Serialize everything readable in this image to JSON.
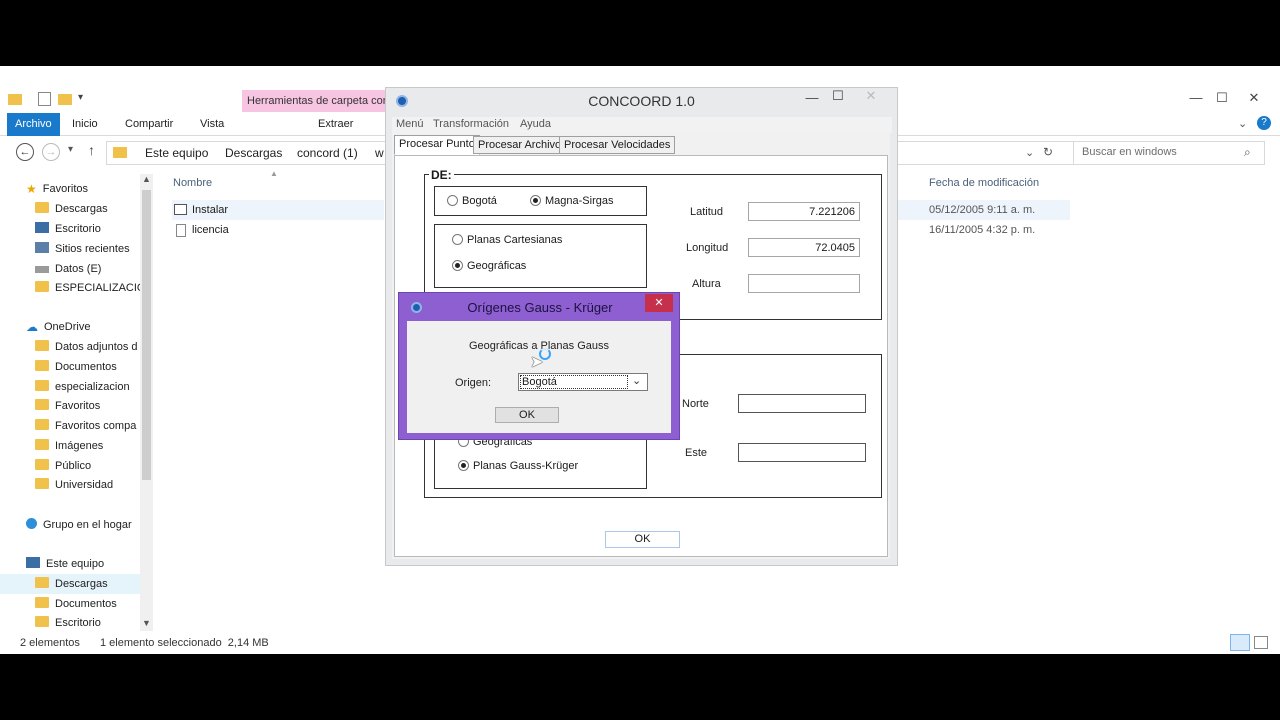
{
  "explorer": {
    "context_tab": "Herramientas de carpeta con",
    "ribbon_tabs": [
      "Archivo",
      "Inicio",
      "Compartir",
      "Vista",
      "Extraer"
    ],
    "breadcrumb": [
      "Este equipo",
      "Descargas",
      "concord (1)",
      "w"
    ],
    "search_placeholder": "Buscar en windows",
    "nav": {
      "favorites": "Favoritos",
      "fav_items": [
        "Descargas",
        "Escritorio",
        "Sitios recientes",
        "Datos (E)",
        "ESPECIALIZACIO"
      ],
      "onedrive": "OneDrive",
      "onedrive_items": [
        "Datos adjuntos d",
        "Documentos",
        "especializacion",
        "Favoritos",
        "Favoritos compa",
        "Imágenes",
        "Público",
        "Universidad"
      ],
      "homegroup": "Grupo en el hogar",
      "thispc": "Este equipo",
      "pc_items": [
        "Descargas",
        "Documentos",
        "Escritorio"
      ]
    },
    "columns": {
      "name": "Nombre",
      "date": "Fecha de modificación"
    },
    "files": [
      {
        "name": "Instalar",
        "date": "05/12/2005 9:11 a. m."
      },
      {
        "name": "licencia",
        "date": "16/11/2005 4:32 p. m."
      }
    ],
    "status": {
      "count": "2 elementos",
      "selected": "1 elemento seleccionado  2,14 MB"
    }
  },
  "concord": {
    "title": "CONCOORD 1.0",
    "menu": [
      "Menú",
      "Transformación",
      "Ayuda"
    ],
    "tabs": [
      "Procesar Punto",
      "Procesar Archivo",
      "Procesar Velocidades"
    ],
    "de_label": "DE:",
    "datum": {
      "bogota": "Bogotá",
      "magna": "Magna-Sirgas"
    },
    "coord_type": {
      "cartesianas": "Planas Cartesianas",
      "geograficas": "Geográficas"
    },
    "fields": {
      "latitud": "Latitud",
      "latitud_value": "7.221206",
      "longitud": "Longitud",
      "longitud_value": "72.0405",
      "altura": "Altura",
      "altura_value": ""
    },
    "output": {
      "geograficas": "Geográficas",
      "gauss": "Planas Gauss-Krüger",
      "norte": "Norte",
      "este": "Este"
    },
    "ok": "OK"
  },
  "dialog": {
    "title": "Orígenes Gauss - Krüger",
    "message": "Geográficas a Planas Gauss",
    "origin_label": "Origen:",
    "origin_value": "Bogotá",
    "ok": "OK"
  }
}
